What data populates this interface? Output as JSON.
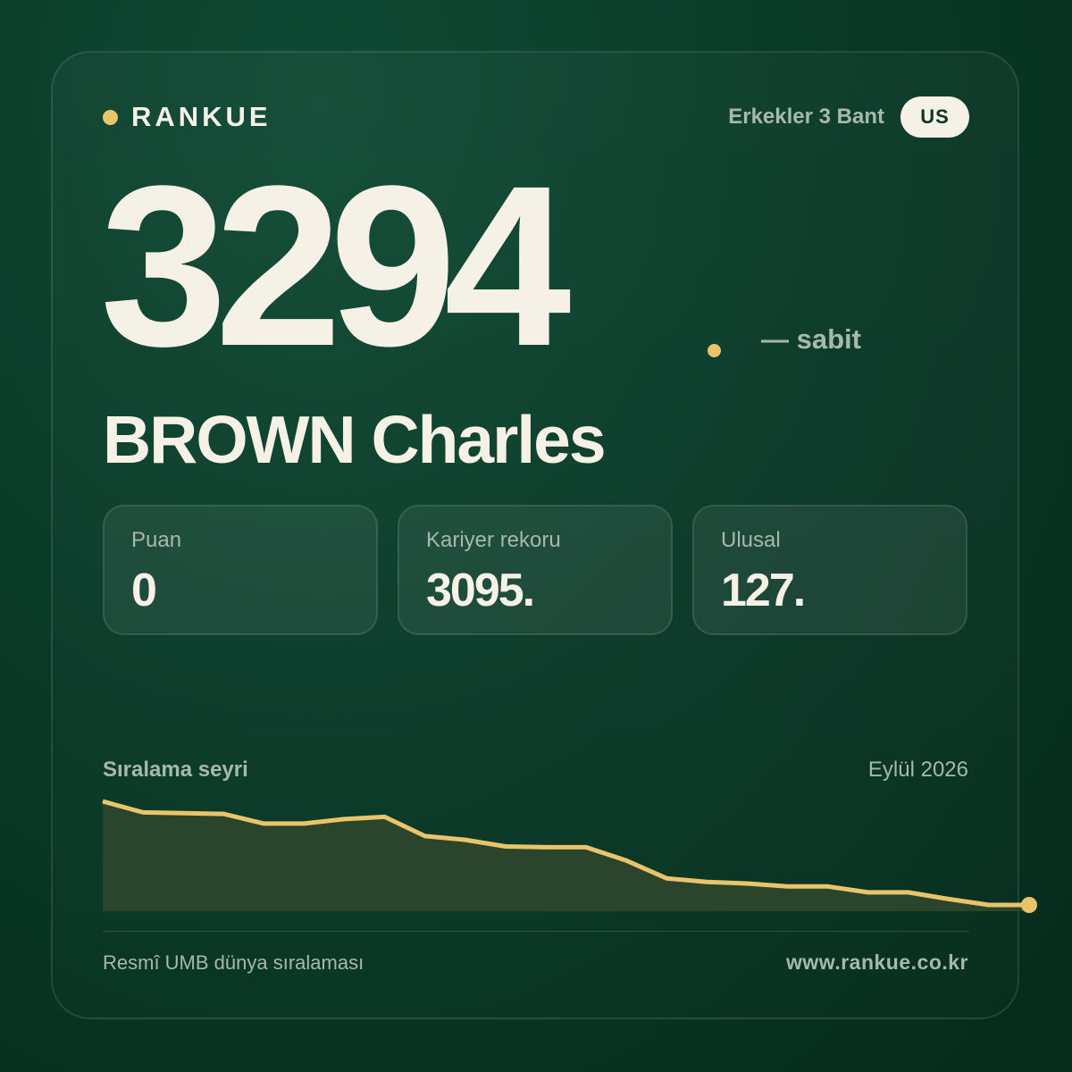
{
  "brand": {
    "name": "RANKUE"
  },
  "header": {
    "category": "Erkekler 3 Bant",
    "country_code": "US"
  },
  "rank": {
    "value": "3294",
    "trend_label": "— sabit"
  },
  "player": {
    "name": "BROWN Charles"
  },
  "stats": [
    {
      "label": "Puan",
      "value": "0"
    },
    {
      "label": "Kariyer rekoru",
      "value": "3095."
    },
    {
      "label": "Ulusal",
      "value": "127."
    }
  ],
  "chart_data": {
    "type": "area",
    "title": "Sıralama seyri",
    "date_label": "Eylül 2026",
    "y_inverted": true,
    "values": [
      3160,
      3175,
      3176,
      3177,
      3190,
      3190,
      3184,
      3181,
      3207,
      3212,
      3221,
      3222,
      3222,
      3240,
      3264,
      3269,
      3271,
      3275,
      3275,
      3283,
      3283,
      3292,
      3300,
      3300
    ],
    "line_color": "#e9c46a",
    "fill_color": "#2b452c",
    "grid": false
  },
  "footer": {
    "source": "Resmî UMB dünya sıralaması",
    "url": "www.rankue.co.kr"
  }
}
